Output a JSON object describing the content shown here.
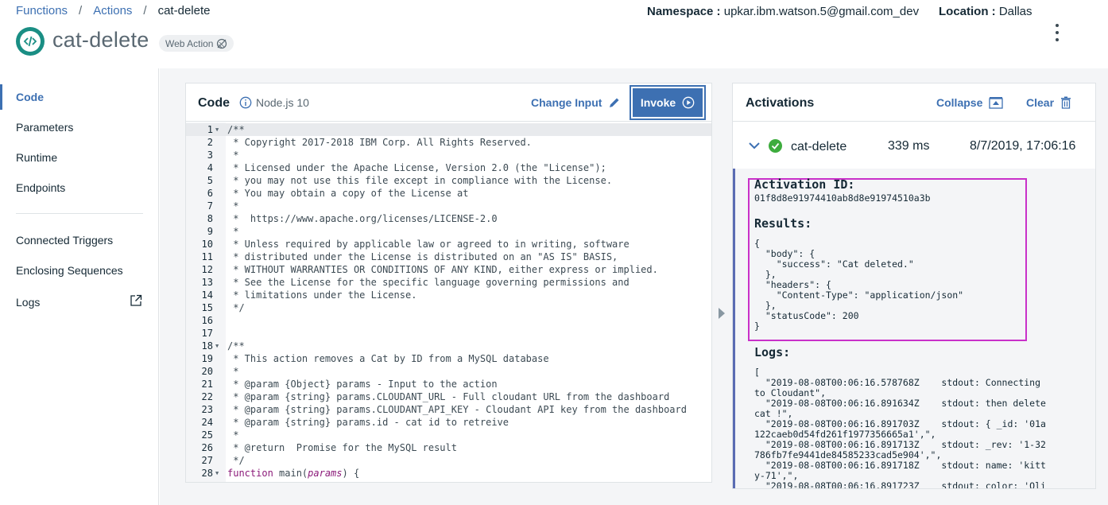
{
  "breadcrumb": {
    "functions": "Functions",
    "actions": "Actions",
    "current": "cat-delete",
    "sep": "/"
  },
  "header": {
    "title": "cat-delete",
    "badge": "Web Action",
    "namespace_label": "Namespace :",
    "namespace_value": "upkar.ibm.watson.5@gmail.com_dev",
    "location_label": "Location :",
    "location_value": "Dallas"
  },
  "sidebar": {
    "items": [
      "Code",
      "Parameters",
      "Runtime",
      "Endpoints",
      "Connected Triggers",
      "Enclosing Sequences",
      "Logs"
    ],
    "active": "Code"
  },
  "code": {
    "title": "Code",
    "runtime": "Node.js 10",
    "change_input": "Change Input",
    "invoke": "Invoke",
    "lines": [
      "/**",
      " * Copyright 2017-2018 IBM Corp. All Rights Reserved.",
      " *",
      " * Licensed under the Apache License, Version 2.0 (the \"License\");",
      " * you may not use this file except in compliance with the License.",
      " * You may obtain a copy of the License at",
      " *",
      " *  https://www.apache.org/licenses/LICENSE-2.0",
      " *",
      " * Unless required by applicable law or agreed to in writing, software",
      " * distributed under the License is distributed on an \"AS IS\" BASIS,",
      " * WITHOUT WARRANTIES OR CONDITIONS OF ANY KIND, either express or implied.",
      " * See the License for the specific language governing permissions and",
      " * limitations under the License.",
      " */",
      "",
      "",
      "/**",
      " * This action removes a Cat by ID from a MySQL database",
      " *",
      " * @param {Object} params - Input to the action",
      " * @param {string} params.CLOUDANT_URL - Full cloudant URL from the dashboard",
      " * @param {string} params.CLOUDANT_API_KEY - Cloudant API key from the dashboard",
      " * @param {string} params.id - cat id to retreive",
      " *",
      " * @return  Promise for the MySQL result",
      " */",
      "function main(params) {"
    ]
  },
  "activations": {
    "title": "Activations",
    "collapse": "Collapse",
    "clear": "Clear",
    "entry": {
      "name": "cat-delete",
      "duration": "339 ms",
      "date": "8/7/2019, 17:06:16"
    },
    "activation_id_label": "Activation ID:",
    "activation_id": "01f8d8e91974410ab8d8e91974510a3b",
    "results_label": "Results:",
    "results": "{\n  \"body\": {\n    \"success\": \"Cat deleted.\"\n  },\n  \"headers\": {\n    \"Content-Type\": \"application/json\"\n  },\n  \"statusCode\": 200\n}",
    "logs_label": "Logs:",
    "logs": "[\n  \"2019-08-08T00:06:16.578768Z    stdout: Connecting\nto Cloudant\",\n  \"2019-08-08T00:06:16.891634Z    stdout: then delete\ncat !\",\n  \"2019-08-08T00:06:16.891703Z    stdout: { _id: '01a\n122caeb0d54fd261f1977356665a1',\",\n  \"2019-08-08T00:06:16.891713Z    stdout: _rev: '1-32\n786fb7fe9441de84585233cad5e904',\",\n  \"2019-08-08T00:06:16.891718Z    stdout: name: 'kitt\ny-71',\",\n  \"2019-08-08T00:06:16.891723Z    stdout: color: 'Oli"
  }
}
